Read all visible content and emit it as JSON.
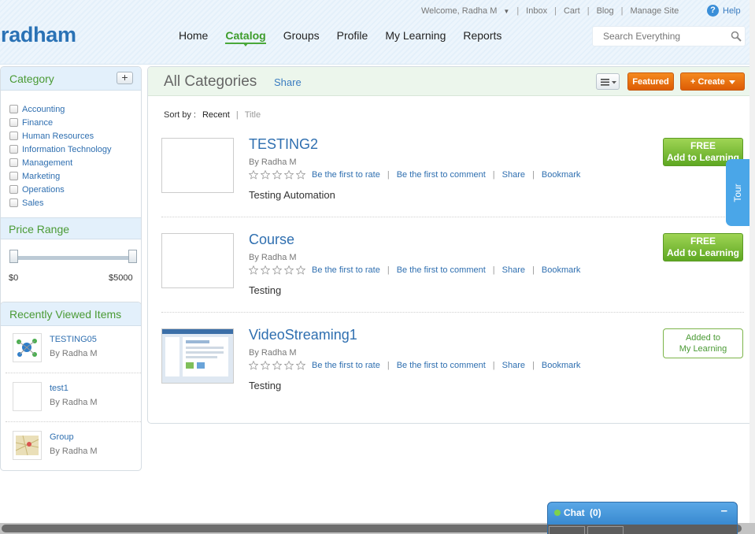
{
  "header": {
    "logo": "radham",
    "welcome": "Welcome, Radha M",
    "top_links": [
      "Inbox",
      "Cart",
      "Blog",
      "Manage Site"
    ],
    "help": "Help",
    "nav": [
      {
        "label": "Home",
        "active": false
      },
      {
        "label": "Catalog",
        "active": true
      },
      {
        "label": "Groups",
        "active": false
      },
      {
        "label": "Profile",
        "active": false
      },
      {
        "label": "My Learning",
        "active": false
      },
      {
        "label": "Reports",
        "active": false
      }
    ],
    "search_placeholder": "Search Everything"
  },
  "sidebar": {
    "category_title": "Category",
    "add_label": "+",
    "categories": [
      "Accounting",
      "Finance",
      "Human Resources",
      "Information Technology",
      "Management",
      "Marketing",
      "Operations",
      "Sales"
    ],
    "price_title": "Price Range",
    "price_min": "$0",
    "price_max": "$5000",
    "recent_title": "Recently Viewed Items",
    "recent": [
      {
        "name": "TESTING05",
        "by": "By Radha M"
      },
      {
        "name": "test1",
        "by": "By Radha M"
      },
      {
        "name": "Group",
        "by": "By Radha M"
      }
    ]
  },
  "content": {
    "title": "All Categories",
    "share": "Share",
    "featured": "Featured",
    "create": "+ Create",
    "sort_label": "Sort by :",
    "sort_recent": "Recent",
    "sort_title": "Title",
    "courses": [
      {
        "title": "TESTING2",
        "by": "By Radha M",
        "rate": "Be the first to rate",
        "comment": "Be the first to comment",
        "share": "Share",
        "bookmark": "Bookmark",
        "desc": "Testing Automation",
        "btn_line1": "FREE",
        "btn_line2": "Add to Learning",
        "added": false
      },
      {
        "title": "Course",
        "by": "By Radha M",
        "rate": "Be the first to rate",
        "comment": "Be the first to comment",
        "share": "Share",
        "bookmark": "Bookmark",
        "desc": "Testing",
        "btn_line1": "FREE",
        "btn_line2": "Add to Learning",
        "added": false
      },
      {
        "title": "VideoStreaming1",
        "by": "By Radha M",
        "rate": "Be the first to rate",
        "comment": "Be the first to comment",
        "share": "Share",
        "bookmark": "Bookmark",
        "desc": "Testing",
        "btn_line1": "Added to",
        "btn_line2": "My Learning",
        "added": true
      }
    ]
  },
  "tour": "Tour",
  "chat": {
    "label": "Chat",
    "count": "(0)",
    "minimize": "–"
  },
  "colors": {
    "brand_blue": "#2a72b5",
    "green": "#4a9a34",
    "orange": "#f07a12",
    "link": "#3a7cc0"
  }
}
